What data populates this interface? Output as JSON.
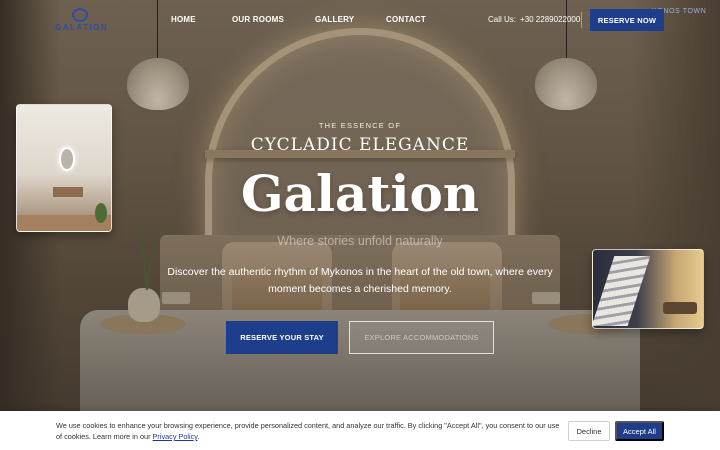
{
  "brand": {
    "logo_text": "GALATION",
    "accent": "#1e3e8c"
  },
  "header": {
    "nav": [
      {
        "label": "HOME"
      },
      {
        "label": "OUR ROOMS"
      },
      {
        "label": "GALLERY"
      },
      {
        "label": "CONTACT"
      }
    ],
    "call_label": "Call Us:",
    "phone": "+30 2289022000",
    "reserve_label": "RESERVE NOW",
    "location_tag": "KONOS TOWN"
  },
  "hero": {
    "eyebrow": "THE ESSENCE OF",
    "subtitle": "CYCLADIC ELEGANCE",
    "title": "Galation",
    "tagline": "Where stories unfold naturally",
    "description": "Discover the authentic rhythm of Mykonos in the heart of the old town, where every moment becomes a cherished memory.",
    "primary_button": "RESERVE YOUR STAY",
    "secondary_button": "EXPLORE ACCOMMODATIONS"
  },
  "cookie": {
    "text": "We use cookies to enhance your browsing experience, provide personalized content, and analyze our traffic. By clicking \"Accept All\", you consent to our use of cookies. Learn more in our",
    "link_label": "Privacy Policy",
    "decline_label": "Decline",
    "accept_label": "Accept All"
  }
}
